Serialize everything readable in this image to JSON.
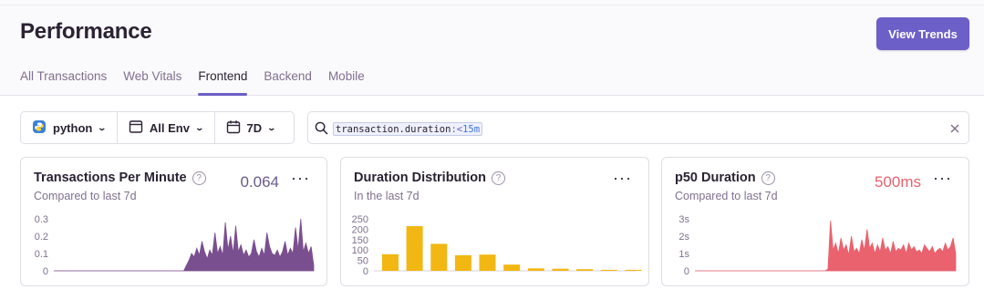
{
  "page": {
    "title": "Performance",
    "primary_button": "View Trends"
  },
  "tabs": [
    {
      "label": "All Transactions",
      "active": false
    },
    {
      "label": "Web Vitals",
      "active": false
    },
    {
      "label": "Frontend",
      "active": true
    },
    {
      "label": "Backend",
      "active": false
    },
    {
      "label": "Mobile",
      "active": false
    }
  ],
  "filters": {
    "project": "python",
    "environment": "All Env",
    "period": "7D"
  },
  "search": {
    "key": "transaction.duration",
    "operator": ":<",
    "value": "15m"
  },
  "colors": {
    "accent": "#6c5fc7",
    "tpm": "#7a4f8f",
    "duration": "#f2b712",
    "p50": "#e9626e"
  },
  "cards": [
    {
      "title": "Transactions Per Minute",
      "subtitle": "Compared to last 7d",
      "value": "0.064",
      "chart_data": {
        "type": "area",
        "yticks": [
          "0.3",
          "0.2",
          "0.1",
          "0"
        ],
        "ylim": [
          0,
          0.3
        ],
        "values": [
          0,
          0,
          0,
          0,
          0,
          0,
          0,
          0,
          0,
          0,
          0,
          0,
          0,
          0,
          0,
          0,
          0,
          0,
          0,
          0,
          0,
          0,
          0,
          0,
          0,
          0,
          0,
          0,
          0,
          0,
          0,
          0,
          0,
          0,
          0,
          0,
          0,
          0,
          0,
          0,
          0,
          0,
          0,
          0,
          0,
          0,
          0,
          0,
          0,
          0,
          0,
          0.03,
          0.06,
          0.1,
          0.08,
          0.13,
          0.09,
          0.17,
          0.11,
          0.07,
          0.12,
          0.09,
          0.22,
          0.1,
          0.14,
          0.09,
          0.28,
          0.12,
          0.2,
          0.1,
          0.26,
          0.11,
          0.15,
          0.09,
          0.12,
          0.08,
          0.1,
          0.18,
          0.11,
          0.08,
          0.13,
          0.09,
          0.22,
          0.14,
          0.1,
          0.09,
          0.12,
          0.08,
          0.11,
          0.17,
          0.09,
          0.13,
          0.1,
          0.25,
          0.12,
          0.3,
          0.11,
          0.16,
          0.1,
          0.14,
          0.03
        ]
      }
    },
    {
      "title": "Duration Distribution",
      "subtitle": "In the last 7d",
      "value": "",
      "chart_data": {
        "type": "bar",
        "yticks": [
          "250",
          "200",
          "150",
          "100",
          "50",
          "0"
        ],
        "ylim": [
          0,
          250
        ],
        "values": [
          80,
          215,
          130,
          75,
          78,
          30,
          12,
          10,
          8,
          5,
          5
        ]
      }
    },
    {
      "title": "p50 Duration",
      "subtitle": "Compared to last 7d",
      "value": "500ms",
      "chart_data": {
        "type": "area",
        "yticks": [
          "3s",
          "2s",
          "1s",
          "0"
        ],
        "ylim": [
          0,
          3
        ],
        "values": [
          0,
          0,
          0,
          0,
          0,
          0,
          0,
          0,
          0,
          0,
          0,
          0,
          0,
          0,
          0,
          0,
          0,
          0,
          0,
          0,
          0,
          0,
          0,
          0,
          0,
          0,
          0,
          0,
          0,
          0,
          0,
          0,
          0,
          0,
          0,
          0,
          0,
          0,
          0,
          0,
          0,
          0,
          0,
          0,
          0,
          0,
          0,
          0,
          0,
          0,
          0,
          0.1,
          2.9,
          1.2,
          1.6,
          1.0,
          1.9,
          1.2,
          1.5,
          0.9,
          2.0,
          1.1,
          1.3,
          1.0,
          1.8,
          1.2,
          2.4,
          1.3,
          1.6,
          1.0,
          1.5,
          1.1,
          1.9,
          1.2,
          1.4,
          1.0,
          1.7,
          1.1,
          1.3,
          1.2,
          1.5,
          1.0,
          1.6,
          1.2,
          1.4,
          1.1,
          1.2,
          1.0,
          1.5,
          1.3,
          1.1,
          1.4,
          1.0,
          1.2,
          1.3,
          1.1,
          1.6,
          1.2,
          1.4,
          1.9,
          1.0
        ]
      }
    }
  ]
}
